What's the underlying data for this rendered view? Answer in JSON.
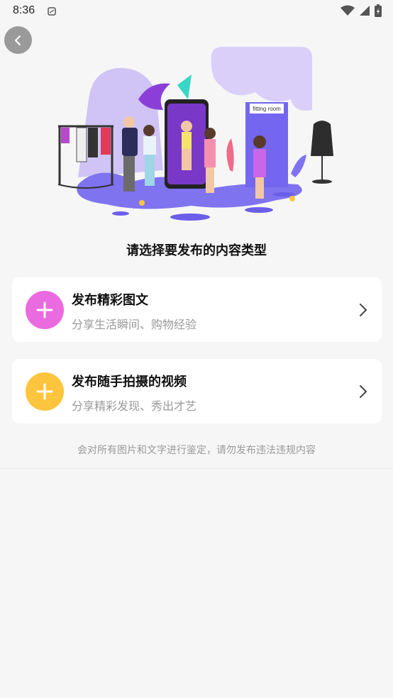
{
  "status_bar": {
    "time": "8:36"
  },
  "hero": {
    "fitting_room_sign": "fitting room"
  },
  "prompt": "请选择要发布的内容类型",
  "options": [
    {
      "title": "发布精彩图文",
      "subtitle": "分享生活瞬间、购物经验",
      "color": "#ea6ae0"
    },
    {
      "title": "发布随手拍摄的视频",
      "subtitle": "分享精彩发现、秀出才艺",
      "color": "#fdc53d"
    }
  ],
  "disclaimer": "会对所有图片和文字进行鉴定，请勿发布违法违规内容",
  "icons": [
    "notification-icon",
    "wifi-icon",
    "signal-icon",
    "battery-icon",
    "back-arrow-icon",
    "plus-icon",
    "chevron-right-icon"
  ]
}
